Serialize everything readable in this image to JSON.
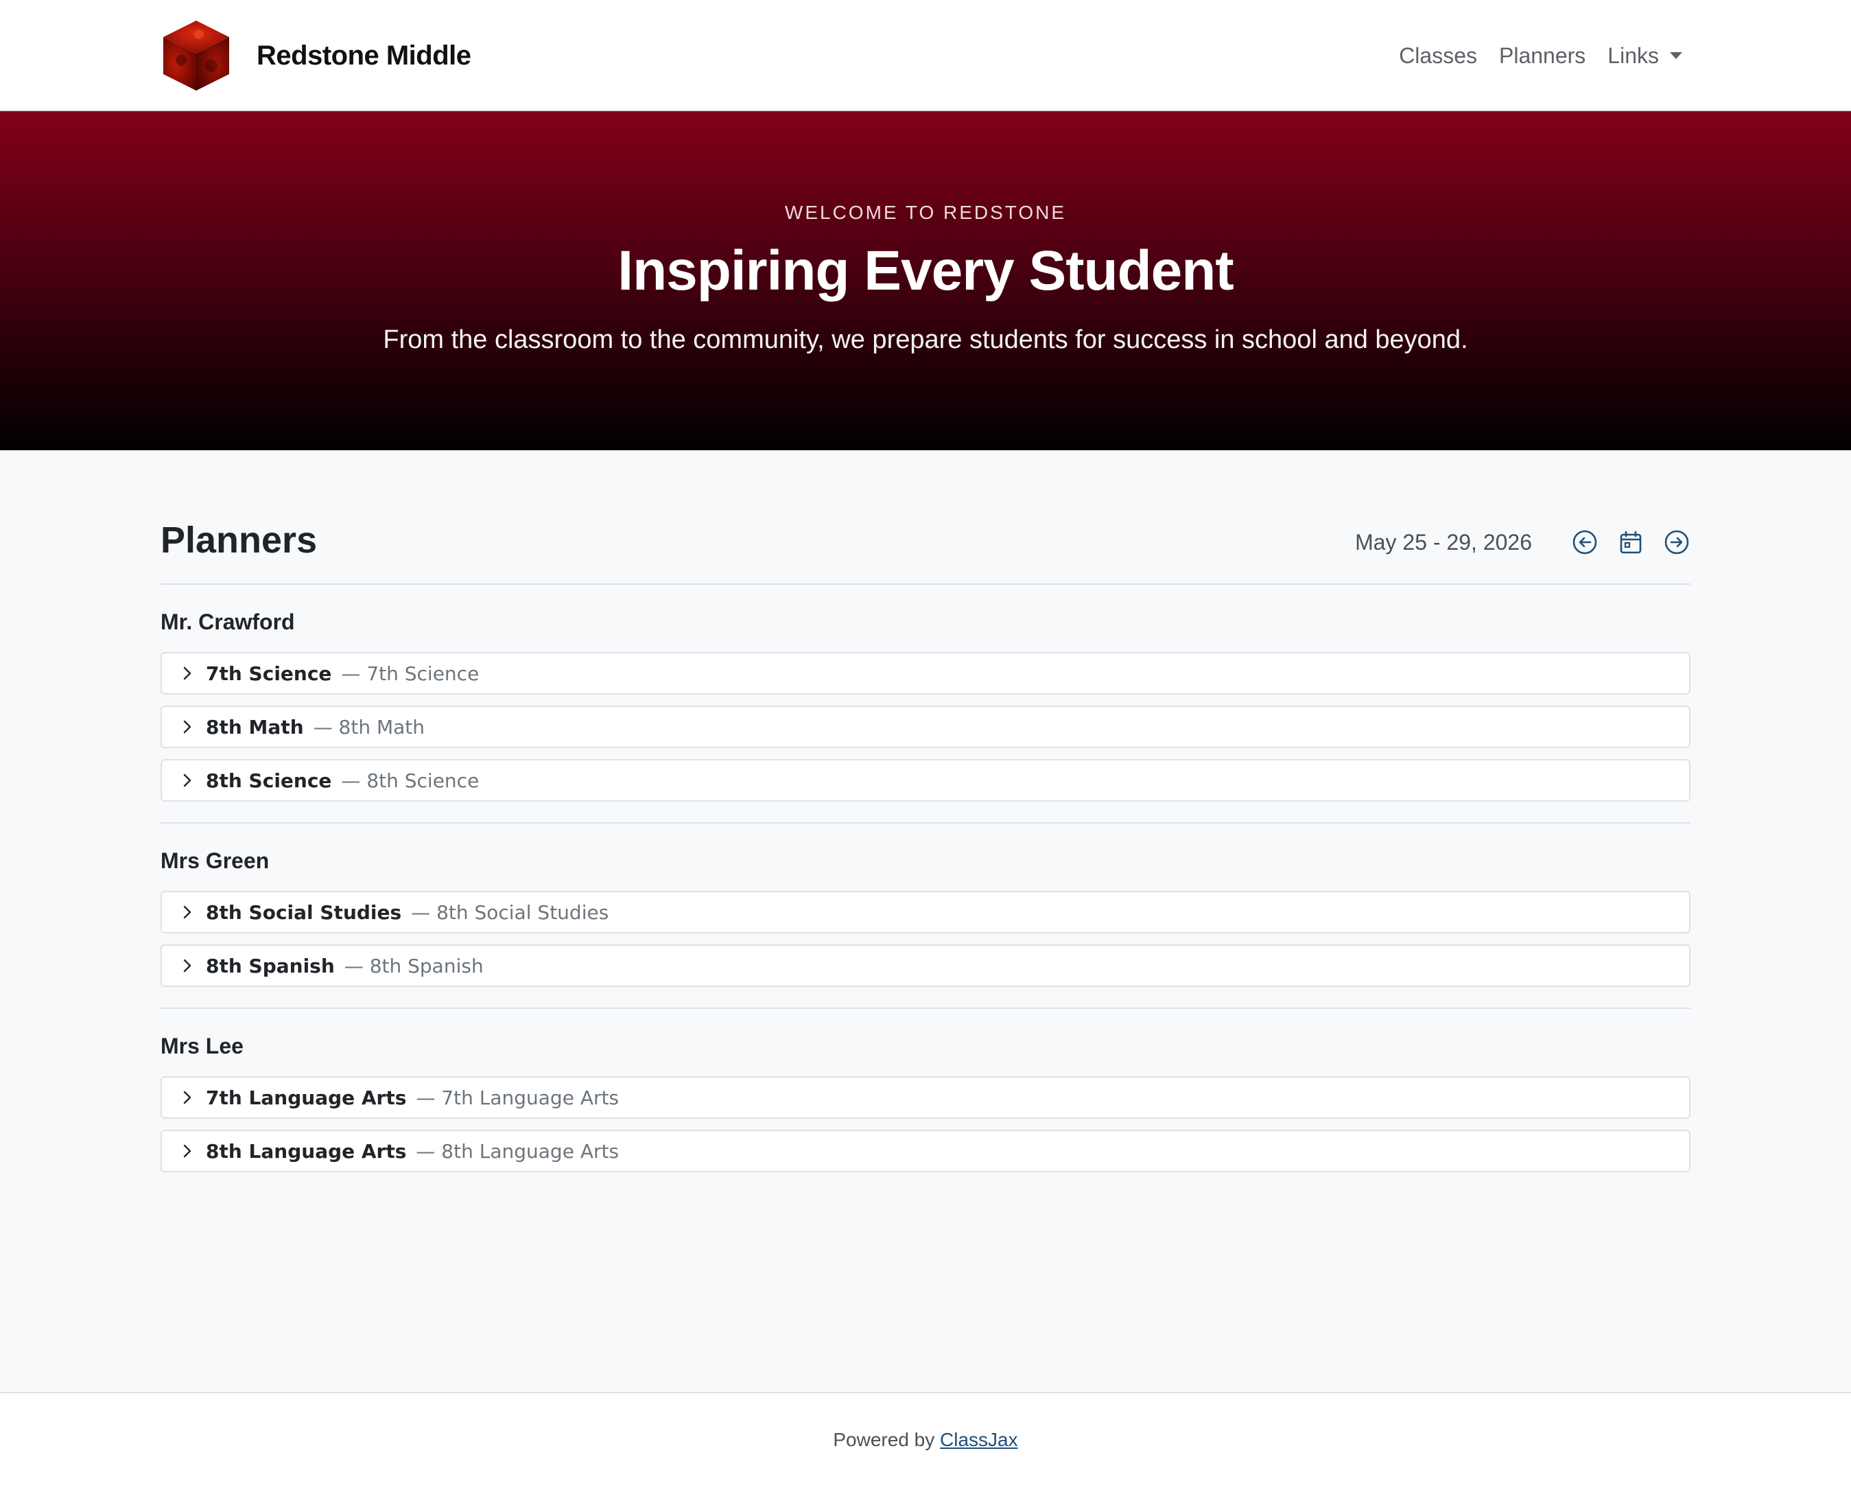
{
  "brand": {
    "name": "Redstone Middle",
    "logo": "red-cube-logo"
  },
  "nav": {
    "classes": "Classes",
    "planners": "Planners",
    "links": "Links"
  },
  "hero": {
    "eyebrow": "WELCOME TO REDSTONE",
    "title": "Inspiring Every Student",
    "subtitle": "From the classroom to the community, we prepare students for success in school and beyond."
  },
  "planners": {
    "title": "Planners",
    "week": "May 25 - 29, 2026",
    "icons": {
      "prev": "arrow-left-circle-icon",
      "calendar": "calendar-icon",
      "next": "arrow-right-circle-icon"
    },
    "teachers": [
      {
        "name": "Mr. Crawford",
        "classes": [
          {
            "title": "7th Science",
            "sub": "— 7th Science"
          },
          {
            "title": "8th Math",
            "sub": "— 8th Math"
          },
          {
            "title": "8th Science",
            "sub": "— 8th Science"
          }
        ]
      },
      {
        "name": "Mrs Green",
        "classes": [
          {
            "title": "8th Social Studies",
            "sub": "— 8th Social Studies"
          },
          {
            "title": "8th Spanish",
            "sub": "— 8th Spanish"
          }
        ]
      },
      {
        "name": "Mrs Lee",
        "classes": [
          {
            "title": "7th Language Arts",
            "sub": "— 7th Language Arts"
          },
          {
            "title": "8th Language Arts",
            "sub": "— 8th Language Arts"
          }
        ]
      }
    ]
  },
  "footer": {
    "prefix": "Powered by",
    "link": "ClassJax"
  },
  "colors": {
    "hero_top": "#82001a",
    "hero_bottom": "#000000",
    "link": "#1f4f7a",
    "background": "#f8f9fa"
  }
}
